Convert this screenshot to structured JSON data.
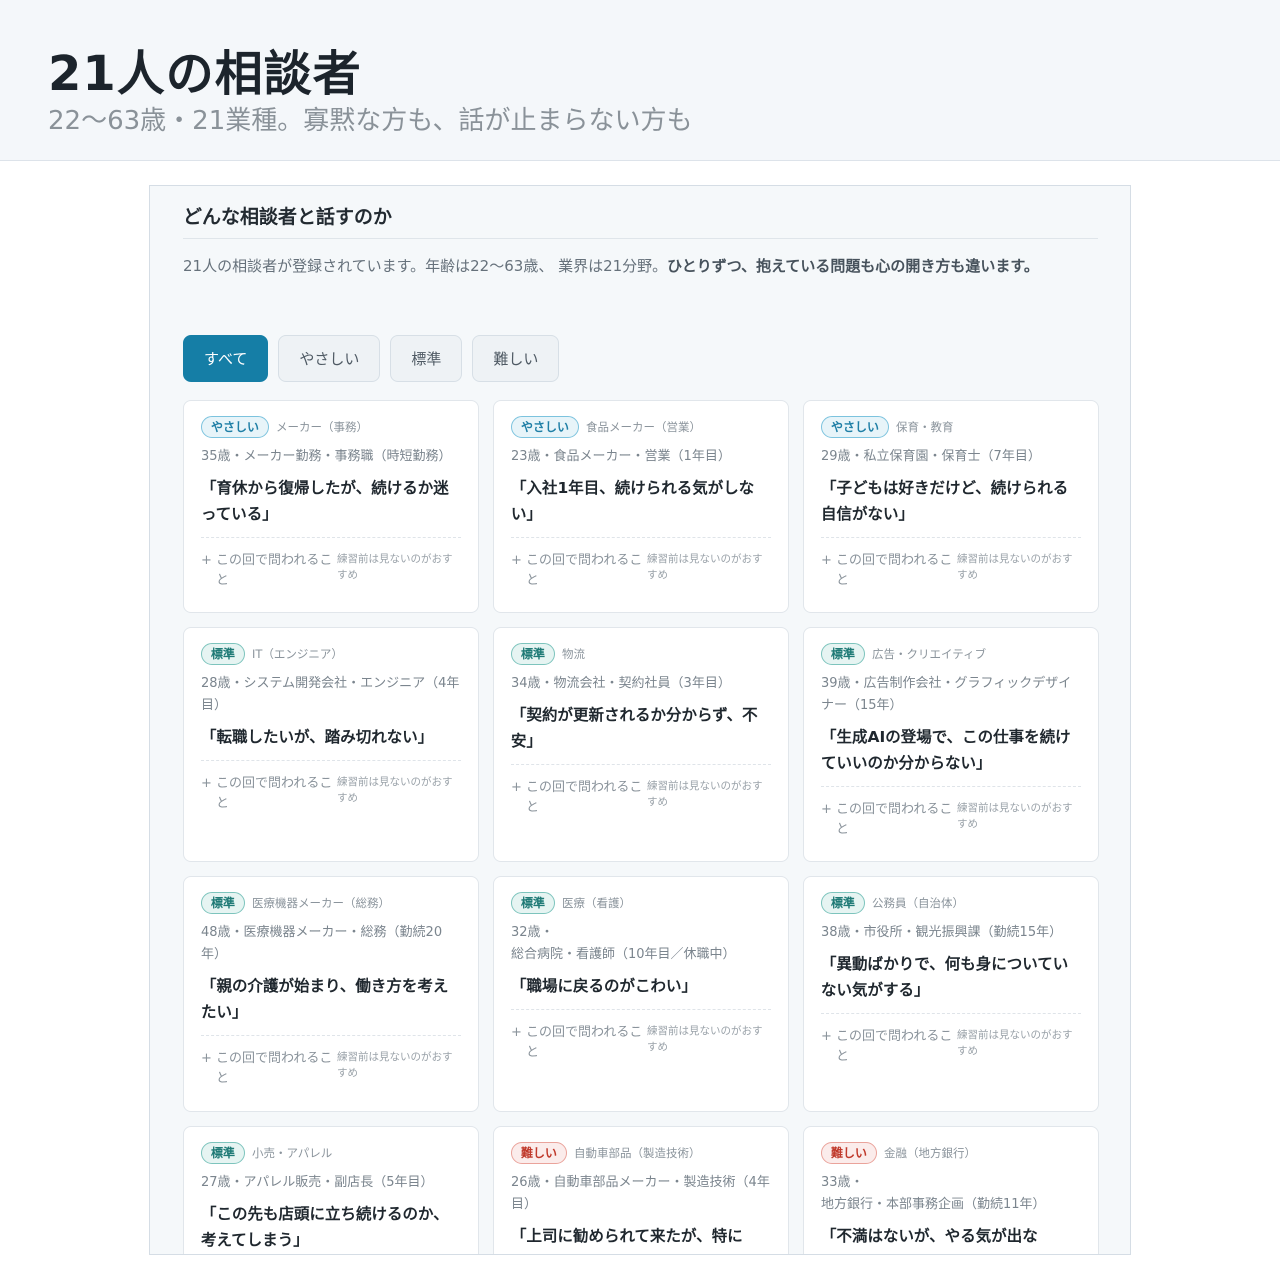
{
  "header": {
    "title": "21人の相談者",
    "subtitle": "22〜63歳・21業種。寡黙な方も、話が止まらない方も"
  },
  "panel": {
    "title": "どんな相談者と話すのか",
    "intro_plain": "21人の相談者が登録されています。年齢は22〜63歳、 業界は21分野。",
    "intro_bold": "ひとりずつ、抱えている問題も心の開き方も違います。"
  },
  "filters": [
    {
      "label": "すべて",
      "active": true
    },
    {
      "label": "やさしい",
      "active": false
    },
    {
      "label": "標準",
      "active": false
    },
    {
      "label": "難しい",
      "active": false
    }
  ],
  "card_footer": {
    "plus": "+",
    "asked": "この回で問われること",
    "note": "練習前は見ないのがおすすめ"
  },
  "cards": [
    {
      "level": "やさしい",
      "kind": "easy",
      "industry": "メーカー（事務）",
      "profile": "35歳・メーカー勤務・事務職（時短勤務）",
      "quote": "「育休から復帰したが、続けるか迷っている」"
    },
    {
      "level": "やさしい",
      "kind": "easy",
      "industry": "食品メーカー（営業）",
      "profile": "23歳・食品メーカー・営業（1年目）",
      "quote": "「入社1年目、続けられる気がしない」"
    },
    {
      "level": "やさしい",
      "kind": "easy",
      "industry": "保育・教育",
      "profile": "29歳・私立保育園・保育士（7年目）",
      "quote": "「子どもは好きだけど、続けられる自信がない」"
    },
    {
      "level": "標準",
      "kind": "std",
      "industry": "IT（エンジニア）",
      "profile": "28歳・システム開発会社・エンジニア（4年目）",
      "quote": "「転職したいが、踏み切れない」"
    },
    {
      "level": "標準",
      "kind": "std",
      "industry": "物流",
      "profile": "34歳・物流会社・契約社員（3年目）",
      "quote": "「契約が更新されるか分からず、不安」"
    },
    {
      "level": "標準",
      "kind": "std",
      "industry": "広告・クリエイティブ",
      "profile": "39歳・広告制作会社・グラフィックデザイナー（15年）",
      "quote": "「生成AIの登場で、この仕事を続けていいのか分からない」"
    },
    {
      "level": "標準",
      "kind": "std",
      "industry": "医療機器メーカー（総務）",
      "profile": "48歳・医療機器メーカー・総務（勤続20年）",
      "quote": "「親の介護が始まり、働き方を考えたい」"
    },
    {
      "level": "標準",
      "kind": "std",
      "industry": "医療（看護）",
      "profile": "32歳・\n総合病院・看護師（10年目／休職中）",
      "quote": "「職場に戻るのがこわい」"
    },
    {
      "level": "標準",
      "kind": "std",
      "industry": "公務員（自治体）",
      "profile": "38歳・市役所・観光振興課（勤続15年）",
      "quote": "「異動ばかりで、何も身についていない気がする」"
    },
    {
      "level": "標準",
      "kind": "std",
      "industry": "小売・アパレル",
      "profile": "27歳・アパレル販売・副店長（5年目）",
      "quote": "「この先も店頭に立ち続けるのか、考えてしまう」"
    },
    {
      "level": "難しい",
      "kind": "hard",
      "industry": "自動車部品（製造技術）",
      "profile": "26歳・自動車部品メーカー・製造技術（4年目）",
      "quote": "「上司に勧められて来たが、特に"
    },
    {
      "level": "難しい",
      "kind": "hard",
      "industry": "金融（地方銀行）",
      "profile": "33歳・\n地方銀行・本部事務企画（勤続11年）",
      "quote": "「不満はないが、やる気が出な"
    }
  ]
}
